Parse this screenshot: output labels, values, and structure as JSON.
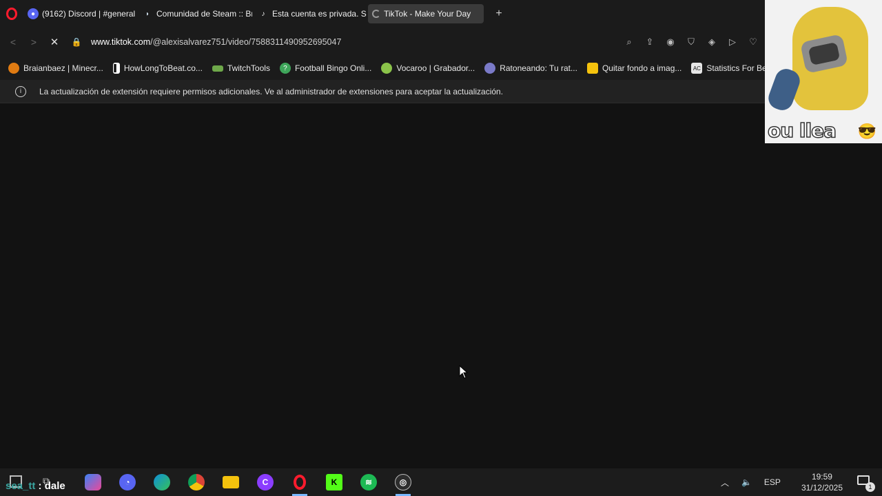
{
  "tabs": [
    {
      "label": "(9162) Discord | #general",
      "icon": "discord-icon",
      "badge": "9k+",
      "color": "#5865f2"
    },
    {
      "label": "Comunidad de Steam :: Br",
      "icon": "steam-icon",
      "color": "#1b2838"
    },
    {
      "label": "Esta cuenta es privada. Sig",
      "icon": "tiktok-icon",
      "color": "#000000"
    },
    {
      "label": "TikTok - Make Your Day",
      "icon": "loading-spinner-icon",
      "active": true
    }
  ],
  "address": {
    "url_domain": "www.tiktok.com",
    "url_path": "/@alexisalvarez751/video/7588311490952695047"
  },
  "bookmarks": [
    {
      "label": "Braianbaez | Minecr...",
      "icon": "pumpkin-icon",
      "color": "#e07b12"
    },
    {
      "label": "HowLongToBeat.co...",
      "icon": "hltb-icon",
      "color": "#ffffff"
    },
    {
      "label": "TwitchTools",
      "icon": "twitchtools-icon",
      "color": "#6ea84a"
    },
    {
      "label": "Football Bingo Onli...",
      "icon": "question-icon",
      "color": "#3ea55a"
    },
    {
      "label": "Vocaroo | Grabador...",
      "icon": "vocaroo-icon",
      "color": "#8bc34a"
    },
    {
      "label": "Ratoneando: Tu rat...",
      "icon": "mouse-icon",
      "color": "#7a7ac8"
    },
    {
      "label": "Quitar fondo a imag...",
      "icon": "removebg-icon",
      "color": "#f4c20d"
    },
    {
      "label": "Statistics For Be",
      "icon": "ac-icon",
      "color": "#e6e6e6"
    }
  ],
  "infobar": {
    "message": "La actualización de extensión requiere permisos adicionales. Ve al administrador de extensiones para aceptar la actualización."
  },
  "overlay": {
    "caption": "ou llea",
    "emoji": "😎"
  },
  "taskbar": {
    "stream_text_user": "sea_tt",
    "stream_text_msg": ": dale",
    "apps": [
      {
        "name": "copilot-icon",
        "color": "#3b82f6",
        "glyph": ""
      },
      {
        "name": "discord-icon",
        "color": "#5865f2",
        "glyph": ""
      },
      {
        "name": "edge-icon",
        "color": "#0f8fd8",
        "glyph": ""
      },
      {
        "name": "chrome-icon",
        "color": "#db4437",
        "glyph": ""
      },
      {
        "name": "file-explorer-icon",
        "color": "#f4c20d",
        "glyph": ""
      },
      {
        "name": "canva-icon",
        "color": "#8b3dff",
        "glyph": "C"
      },
      {
        "name": "opera-icon",
        "color": "#ff1b2d",
        "glyph": "O"
      },
      {
        "name": "kick-icon",
        "color": "#53fc18",
        "glyph": "K"
      },
      {
        "name": "spotify-icon",
        "color": "#1db954",
        "glyph": ""
      },
      {
        "name": "obs-icon",
        "color": "#2d2d2d",
        "glyph": ""
      }
    ],
    "language": "ESP",
    "time": "19:59",
    "date": "31/12/2025",
    "notifications": "1"
  }
}
